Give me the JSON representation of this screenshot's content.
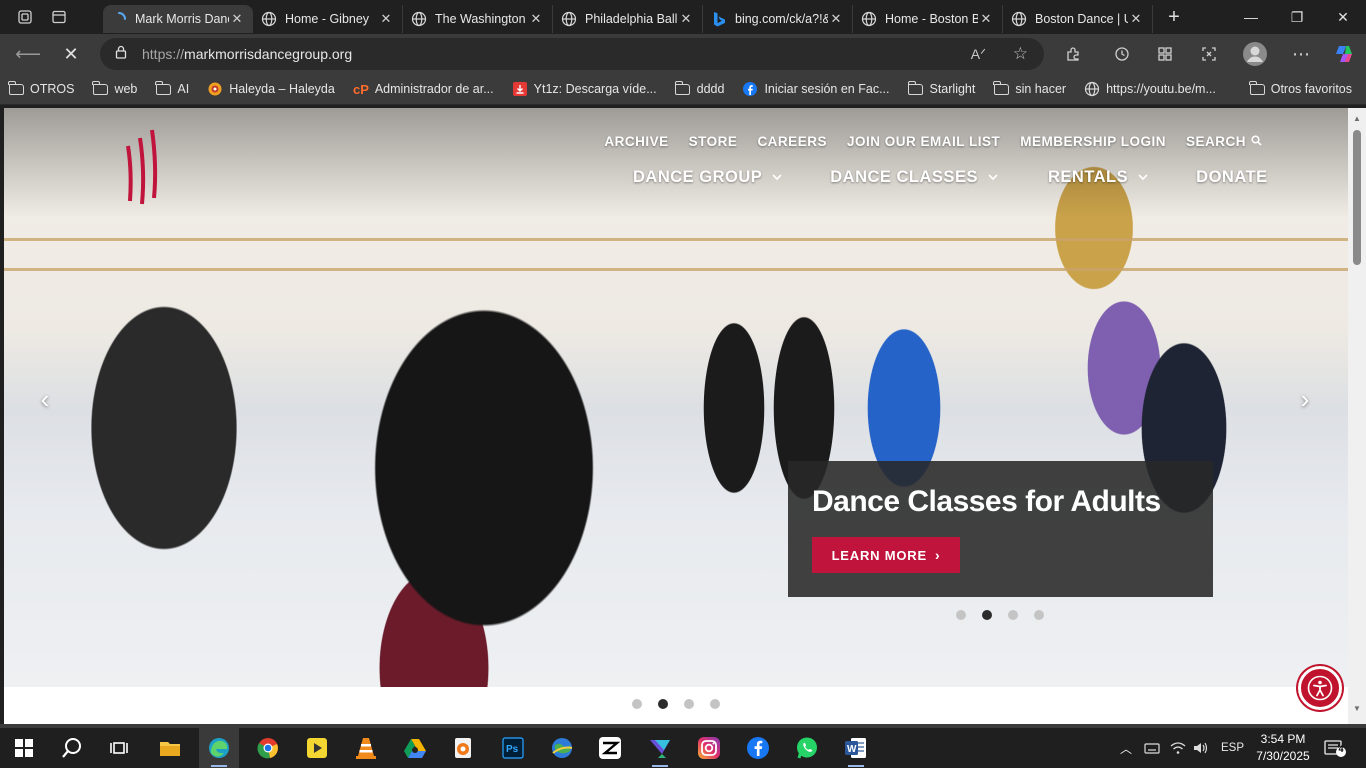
{
  "browser": {
    "tabs": [
      {
        "title": "Mark Morris Danc",
        "icon": "loading-spinner-icon",
        "active": true
      },
      {
        "title": "Home - Gibney",
        "icon": "globe-icon"
      },
      {
        "title": "The Washington",
        "icon": "globe-icon"
      },
      {
        "title": "Philadelphia Ball",
        "icon": "globe-icon"
      },
      {
        "title": "bing.com/ck/a?!&",
        "icon": "bing-icon"
      },
      {
        "title": "Home - Boston B",
        "icon": "globe-icon"
      },
      {
        "title": "Boston Dance | U",
        "icon": "globe-icon"
      }
    ],
    "url": {
      "protocol": "https://",
      "host": "markmorrisdancegroup.org"
    },
    "bookmarks": [
      {
        "label": "OTROS",
        "icon": "folder-icon"
      },
      {
        "label": "web",
        "icon": "folder-icon"
      },
      {
        "label": "AI",
        "icon": "folder-icon"
      },
      {
        "label": "Haleyda – Haleyda",
        "icon": "haleyda-site-icon"
      },
      {
        "label": "Administrador de ar...",
        "icon": "cpanel-icon"
      },
      {
        "label": "Yt1z: Descarga víde...",
        "icon": "download-icon"
      },
      {
        "label": "dddd",
        "icon": "folder-icon"
      },
      {
        "label": "Iniciar sesión en Fac...",
        "icon": "facebook-icon"
      },
      {
        "label": "Starlight",
        "icon": "folder-icon"
      },
      {
        "label": "sin hacer",
        "icon": "folder-icon"
      },
      {
        "label": "https://youtu.be/m...",
        "icon": "globe-icon"
      }
    ],
    "other_bookmarks": "Otros favoritos"
  },
  "site": {
    "utility_nav": [
      "ARCHIVE",
      "STORE",
      "CAREERS",
      "JOIN OUR EMAIL LIST",
      "MEMBERSHIP LOGIN",
      "SEARCH"
    ],
    "main_nav": [
      {
        "label": "DANCE GROUP",
        "has_dropdown": true
      },
      {
        "label": "DANCE CLASSES",
        "has_dropdown": true
      },
      {
        "label": "RENTALS",
        "has_dropdown": true
      },
      {
        "label": "DONATE",
        "has_dropdown": false
      }
    ],
    "slide": {
      "title": "Dance Classes for Adults",
      "cta": "LEARN MORE"
    },
    "slide_count": 4,
    "active_slide": 2,
    "accent_color": "#c0143c"
  },
  "taskbar": {
    "language": "ESP",
    "time": "3:54 PM",
    "date": "7/30/2025",
    "notifications": "4"
  }
}
